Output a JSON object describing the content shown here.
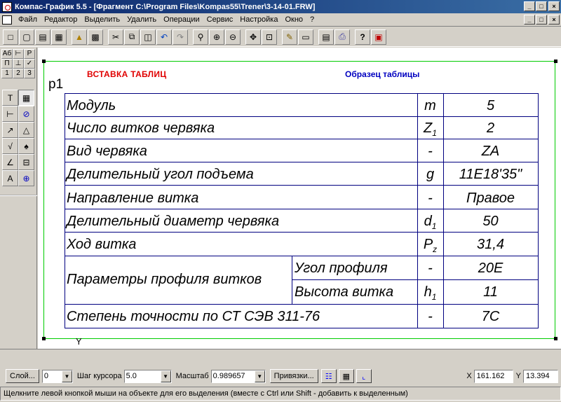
{
  "window": {
    "title": "Компас-График 5.5 - [Фрагмент C:\\Program Files\\Kompas55\\Trener\\3-14-01.FRW]",
    "caption_buttons": [
      "_",
      "□",
      "×"
    ]
  },
  "menu": {
    "items": [
      "Файл",
      "Редактор",
      "Выделить",
      "Удалить",
      "Операции",
      "Сервис",
      "Настройка",
      "Окно",
      "?"
    ],
    "doc_caption_buttons": [
      "_",
      "□",
      "×"
    ]
  },
  "toolbar": {
    "icons": [
      "new-document-icon",
      "new-fragment-icon",
      "new-sheet-icon",
      "new-text-icon",
      "open-folder-icon",
      "save-icon",
      "cut-icon",
      "copy-icon",
      "paste-icon",
      "undo-icon",
      "redo-icon",
      "zoom-icon",
      "zoom-in-icon",
      "zoom-out-icon",
      "pan-icon",
      "zoom-window-icon",
      "properties-icon",
      "preview-icon",
      "print-preview-icon",
      "print-icon",
      "context-help-icon",
      "exit-icon"
    ]
  },
  "left_panel": {
    "grid": [
      "Аб",
      "⊢",
      "P",
      "Π",
      "⊥",
      "✓",
      "1",
      "2",
      "3"
    ],
    "tools": [
      "T",
      "▦",
      "⊢",
      "⊘",
      "↗",
      "△",
      "√",
      "♠",
      "∠",
      "⊟",
      "A",
      "⊕"
    ]
  },
  "drawing": {
    "marker": "p1",
    "title_left": "ВСТАВКА ТАБЛИЦ",
    "title_right": "Образец таблицы",
    "axis_y": "Y",
    "rows": [
      {
        "param": "Модуль",
        "sym": "m",
        "sym_sub": "",
        "value": "5"
      },
      {
        "param": "Число витков червяка",
        "sym": "Z",
        "sym_sub": "1",
        "value": "2"
      },
      {
        "param": "Вид червяка",
        "sym": "-",
        "sym_sub": "",
        "value": "ZA"
      },
      {
        "param": "Делительный угол подъема",
        "sym": "g",
        "sym_sub": "",
        "value": "11E18'35\""
      },
      {
        "param": "Направление витка",
        "sym": "-",
        "sym_sub": "",
        "value": "Правое"
      },
      {
        "param": "Делительный диаметр червяка",
        "sym": "d",
        "sym_sub": "1",
        "value": "50"
      },
      {
        "param": "Ход витка",
        "sym": "P",
        "sym_sub": "z",
        "value": "31,4"
      },
      {
        "param": "Параметры профиля витков",
        "sub_param": "Угол профиля",
        "sym": "-",
        "sym_sub": "",
        "value": "20E"
      },
      {
        "sub_param": "Высота витка",
        "sym": "h",
        "sym_sub": "1",
        "value": "11"
      },
      {
        "param": "Степень точности по СТ СЭВ 311-76",
        "sym": "-",
        "sym_sub": "",
        "value": "7C"
      }
    ]
  },
  "statusbar": {
    "layer_button": "Слой...",
    "layer_value": "0",
    "step_label": "Шаг курсора",
    "step_value": "5.0",
    "scale_label": "Масштаб",
    "scale_value": "0.989657",
    "snaps_button": "Привязки...",
    "x_label": "X",
    "x_value": "161.162",
    "y_label": "Y",
    "y_value": "13.394",
    "hint": "Щелкните левой кнопкой мыши на объекте для его выделения (вместе с Ctrl или Shift - добавить к выделенным)"
  }
}
